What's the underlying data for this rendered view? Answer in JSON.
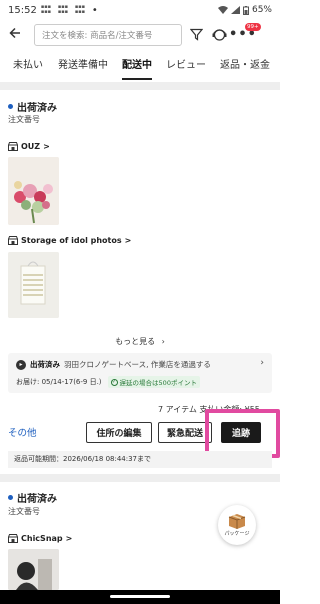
{
  "status_bar": {
    "time": "15:52",
    "battery": "65%",
    "indicators": [
      "signal-icon",
      "wifi-icon",
      "battery-icon"
    ]
  },
  "header": {
    "search_placeholder": "注文を検索: 商品名/注文番号",
    "notification_badge": "99+"
  },
  "tabs": [
    {
      "label": "未払い",
      "active": false
    },
    {
      "label": "発送準備中",
      "active": false
    },
    {
      "label": "配送中",
      "active": true
    },
    {
      "label": "レビュー",
      "active": false
    },
    {
      "label": "返品・返金",
      "active": false
    }
  ],
  "orders": [
    {
      "status": "出荷済み",
      "order_no_label": "注文番号",
      "shops": [
        {
          "name": "OUZ",
          "chevron": ">"
        },
        {
          "name": "Storage of idol photos",
          "chevron": ">"
        }
      ],
      "see_more": "もっと見る",
      "delivery": {
        "status": "出荷済み",
        "description": "羽田クロノゲートベース, 作業店を通過する",
        "eta": "お届け: 05/14-17(6-9 日.)",
        "late_note": "遅延の場合は500ポイント"
      },
      "items_total": "7 アイテム 支払い金額: ¥55",
      "other_link": "その他",
      "buttons": {
        "edit_address": "住所の編集",
        "urgent": "緊急配送",
        "track": "追跡"
      },
      "return_note": "返品可能期間：2026/06/18 08:44:37まで"
    },
    {
      "status": "出荷済み",
      "order_no_label": "注文番号",
      "shops": [
        {
          "name": "ChicSnap",
          "chevron": ">"
        }
      ]
    }
  ],
  "package_button": {
    "label": "パッケージ"
  },
  "colors": {
    "accent_blue": "#1e5fbf",
    "highlight_pink": "#e14aa0",
    "badge_red": "#e34"
  }
}
